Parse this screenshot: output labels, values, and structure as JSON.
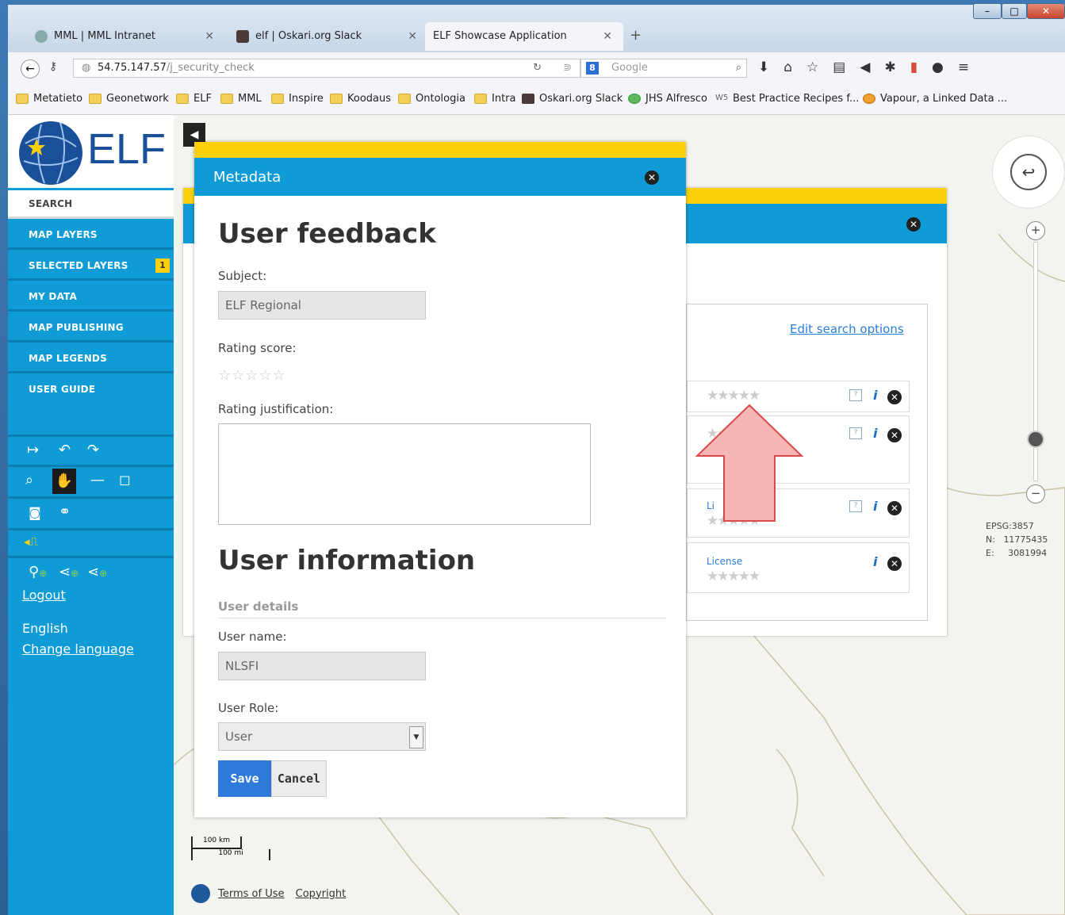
{
  "browser": {
    "tabs": [
      {
        "label": "MML | MML Intranet"
      },
      {
        "label": "elf | Oskari.org Slack"
      },
      {
        "label": "ELF Showcase Application"
      }
    ],
    "new_tab": "+",
    "url_host": "54.75.147.57",
    "url_path": "/j_security_check",
    "search_placeholder": "Google",
    "bookmarks": [
      "Metatieto",
      "Geonetwork",
      "ELF",
      "MML",
      "Inspire",
      "Koodaus",
      "Ontologia",
      "Intra",
      "Oskari.org Slack",
      "JHS Alfresco",
      "Best Practice Recipes f...",
      "Vapour, a Linked Data ..."
    ]
  },
  "sidebar": {
    "logo_text": "ELF",
    "items": [
      "SEARCH",
      "MAP LAYERS",
      "SELECTED LAYERS",
      "MY DATA",
      "MAP PUBLISHING",
      "MAP LEGENDS",
      "USER GUIDE"
    ],
    "selected_layers_badge": "1",
    "logout": "Logout",
    "language": "English",
    "change_language": "Change language"
  },
  "metadata_dialog": {
    "title": "Metadata",
    "heading_feedback": "User feedback",
    "subject_label": "Subject:",
    "subject_value": "ELF Regional",
    "rating_label": "Rating score:",
    "rating_value": 0,
    "justification_label": "Rating justification:",
    "heading_user": "User information",
    "user_details": "User details",
    "username_label": "User name:",
    "username_value": "NLSFI",
    "role_label": "User Role:",
    "role_value": "User",
    "save": "Save",
    "cancel": "Cancel"
  },
  "search_panel": {
    "edit_search_options": "Edit search options",
    "license_1": "Li",
    "license_2": "License"
  },
  "map": {
    "epsg": "EPSG:3857",
    "n_label": "N:",
    "n_value": "11775435",
    "e_label": "E:",
    "e_value": "3081994",
    "scale_km": "100 km",
    "scale_mi": "100 mi",
    "terms": "Terms of Use",
    "copyright": "Copyright"
  },
  "colors": {
    "accent_blue": "#0e9bd6",
    "accent_yellow": "#fed00c",
    "arrow_fill": "#f7b6b6",
    "arrow_stroke": "#d94a4a"
  }
}
